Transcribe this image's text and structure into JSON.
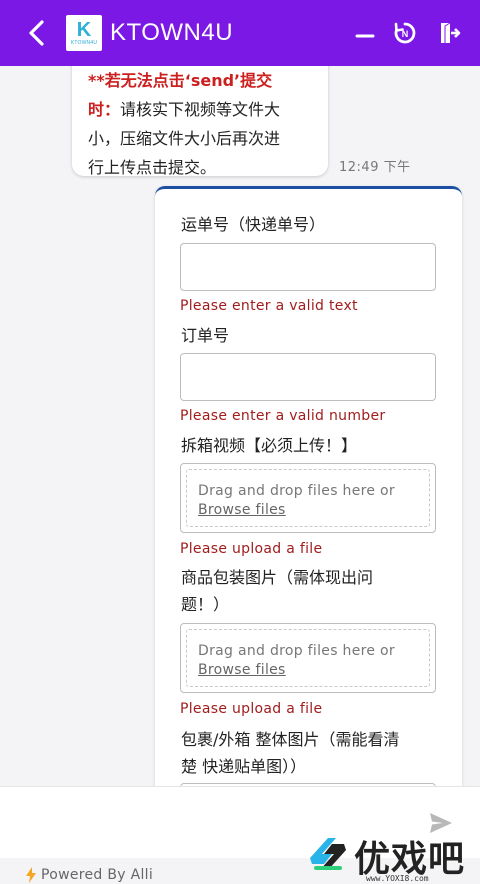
{
  "header": {
    "title": "KTOWN4U",
    "logo_letter": "K",
    "logo_sub": "KTOWN4U",
    "colors": {
      "background": "#7b18e6",
      "icon": "#ffffff"
    }
  },
  "chat": {
    "bot_message": {
      "warn_line1": "**若无法点击‘send’提交",
      "warn_prefix": "时：",
      "body_1": "请核实下视频等文件大",
      "body_2": "小，压缩文件大小后再次进",
      "body_3": "行上传点击提交。"
    },
    "timestamp": "12:49 下午"
  },
  "form": {
    "accent_color": "#1d4fa3",
    "error_color": "#a11d1d",
    "tracking_label": "运单号（快递单号）",
    "tracking_error": "Please enter a valid text",
    "order_label": "订单号",
    "order_error": "Please enter a valid number",
    "video_label": "拆箱视频【必须上传！】",
    "drop_text": "Drag and drop files here or",
    "browse_text": "Browse files",
    "video_error": "Please upload a file",
    "package_label_1": "商品包装图片（需体现出问",
    "package_label_2": "题！）",
    "package_error": "Please upload a file",
    "box_label_1": "包裹/外箱 整体图片（需能看清",
    "box_label_2": "楚 快递贴单图））"
  },
  "composer": {
    "send_icon": "send-icon"
  },
  "footer": {
    "powered_by": "Powered By Alli"
  },
  "watermark": {
    "text": "优戏吧",
    "url": "www.YOXI8.com"
  }
}
